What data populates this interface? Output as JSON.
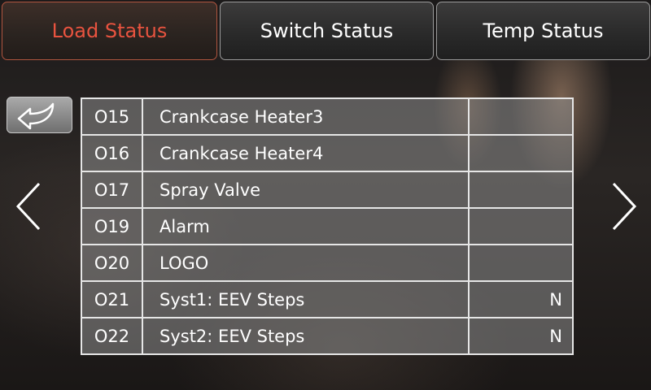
{
  "tabs": [
    {
      "label": "Load Status",
      "active": true
    },
    {
      "label": "Switch Status",
      "active": false
    },
    {
      "label": "Temp Status",
      "active": false
    }
  ],
  "colors": {
    "active_tab_text": "#e8533f",
    "text": "#ffffff"
  },
  "icons": {
    "back": "back-arrow-icon",
    "prev": "chevron-left-icon",
    "next": "chevron-right-icon"
  },
  "rows": [
    {
      "code": "O15",
      "name": "Crankcase Heater3",
      "value": ""
    },
    {
      "code": "O16",
      "name": "Crankcase Heater4",
      "value": ""
    },
    {
      "code": "O17",
      "name": "Spray Valve",
      "value": ""
    },
    {
      "code": "O19",
      "name": "Alarm",
      "value": ""
    },
    {
      "code": "O20",
      "name": "LOGO",
      "value": ""
    },
    {
      "code": "O21",
      "name": "Syst1: EEV Steps",
      "value": "N"
    },
    {
      "code": "O22",
      "name": "Syst2: EEV Steps",
      "value": "N"
    }
  ]
}
